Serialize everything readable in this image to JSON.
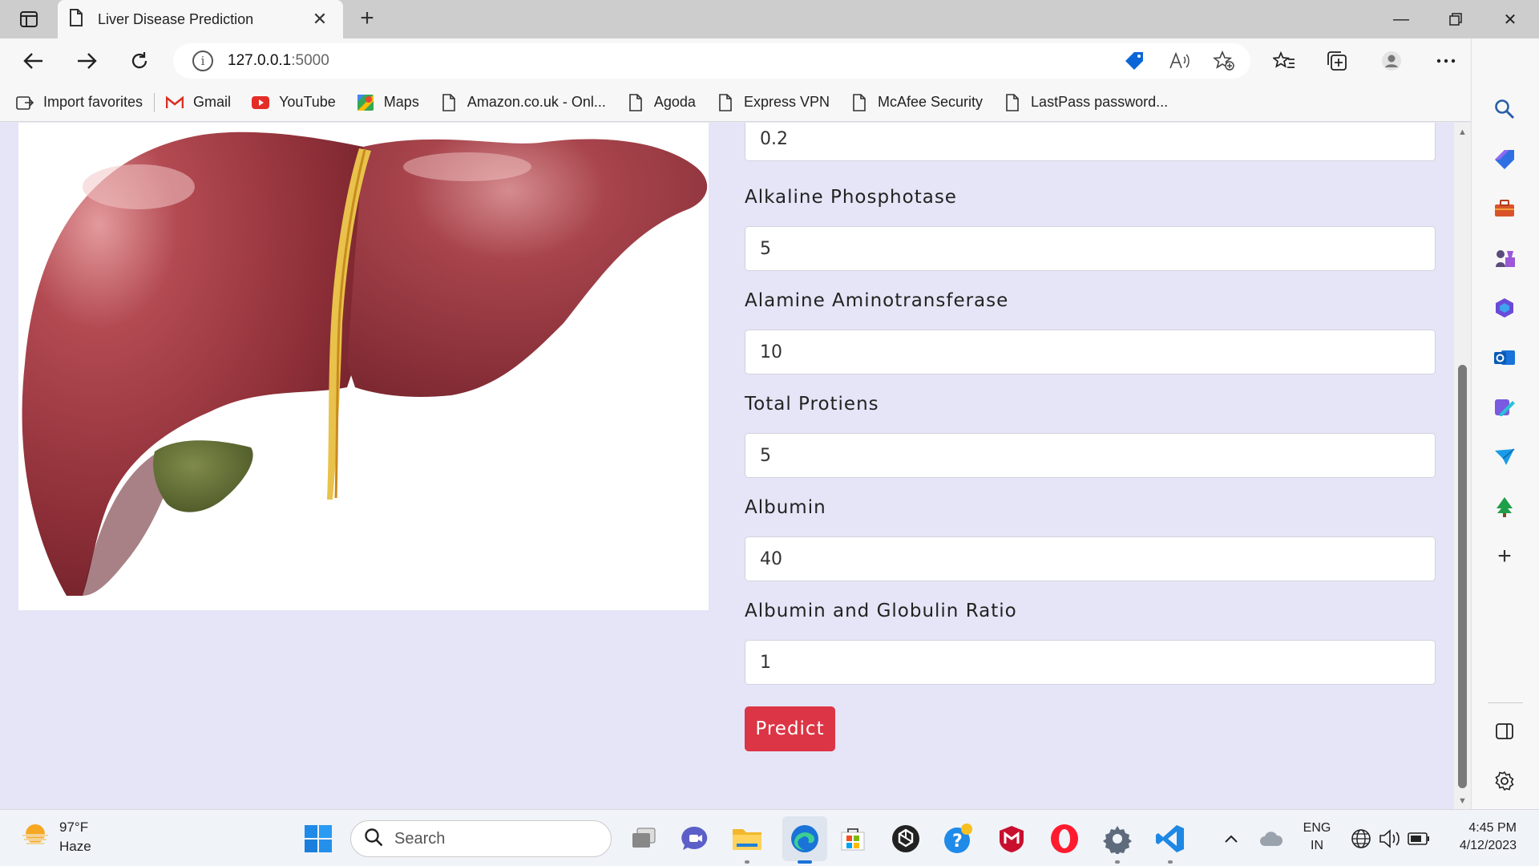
{
  "browser": {
    "tab_title": "Liver Disease Prediction",
    "url_host": "127.0.0.1",
    "url_port": ":5000",
    "bookmarks": [
      {
        "label": "Import favorites"
      },
      {
        "label": "Gmail"
      },
      {
        "label": "YouTube"
      },
      {
        "label": "Maps"
      },
      {
        "label": "Amazon.co.uk - Onl..."
      },
      {
        "label": "Agoda"
      },
      {
        "label": "Express VPN"
      },
      {
        "label": "McAfee Security"
      },
      {
        "label": "LastPass password..."
      }
    ]
  },
  "form": {
    "top_value": "0.2",
    "fields": [
      {
        "label": "Alkaline Phosphotase",
        "value": "5"
      },
      {
        "label": "Alamine Aminotransferase",
        "value": "10"
      },
      {
        "label": "Total Protiens",
        "value": "5"
      },
      {
        "label": "Albumin",
        "value": "40"
      },
      {
        "label": "Albumin and Globulin Ratio",
        "value": "1"
      }
    ],
    "predict_label": "Predict"
  },
  "taskbar": {
    "weather_temp": "97°F",
    "weather_desc": "Haze",
    "search_label": "Search",
    "lang_top": "ENG",
    "lang_bottom": "IN",
    "time": "4:45 PM",
    "date": "4/12/2023"
  },
  "colors": {
    "predict_button": "#dc3545",
    "page_background": "#e5e5f7",
    "edge_accent": "#1a73d8"
  }
}
